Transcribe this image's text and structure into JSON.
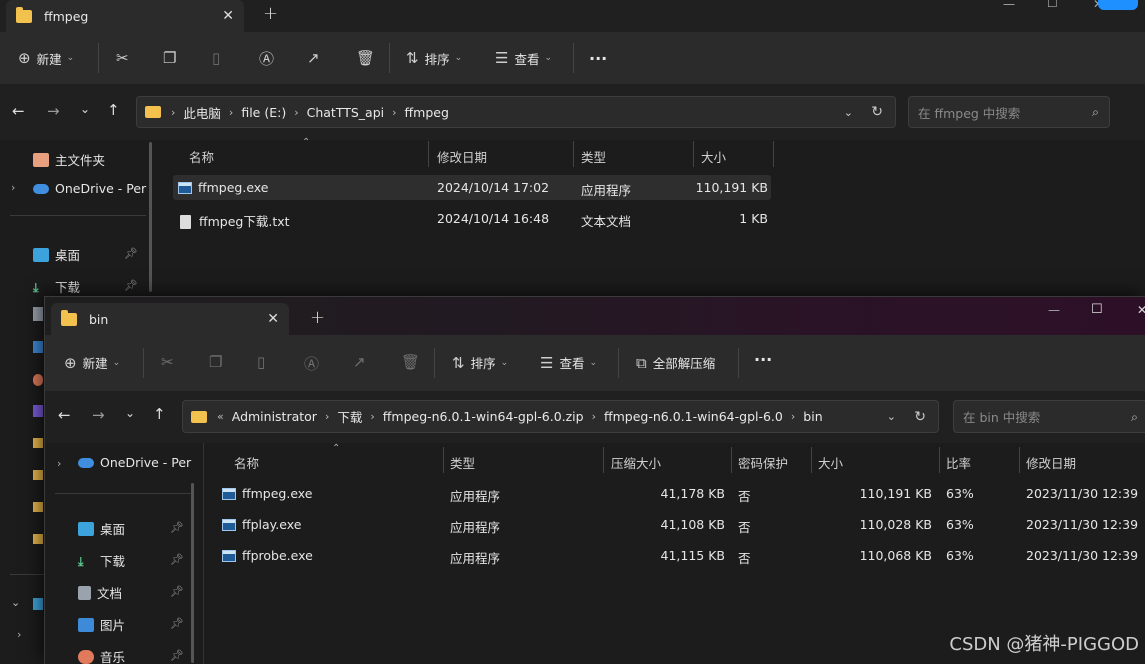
{
  "back_window": {
    "tab_title": "ffmpeg",
    "toolbar": {
      "new_label": "新建",
      "sort_label": "排序",
      "view_label": "查看",
      "more": "···"
    },
    "breadcrumb": [
      "此电脑",
      "file (E:)",
      "ChatTTS_api",
      "ffmpeg"
    ],
    "search_placeholder": "在 ffmpeg 中搜索",
    "nav": [
      {
        "label": "主文件夹",
        "icon": "home-icon"
      },
      {
        "label": "OneDrive - Per",
        "icon": "onedrive-icon"
      },
      {
        "label": "桌面",
        "icon": "desktop-icon"
      },
      {
        "label": "下载",
        "icon": "download-icon"
      }
    ],
    "columns": [
      "名称",
      "修改日期",
      "类型",
      "大小"
    ],
    "files": [
      {
        "name": "ffmpeg.exe",
        "date": "2024/10/14 17:02",
        "type": "应用程序",
        "size": "110,191 KB",
        "icon": "exe-icon"
      },
      {
        "name": "ffmpeg下载.txt",
        "date": "2024/10/14 16:48",
        "type": "文本文档",
        "size": "1 KB",
        "icon": "text-file-icon"
      }
    ]
  },
  "front_window": {
    "tab_title": "bin",
    "toolbar": {
      "new_label": "新建",
      "sort_label": "排序",
      "view_label": "查看",
      "extract_label": "全部解压缩",
      "more": "···"
    },
    "breadcrumb_prefix": "«",
    "breadcrumb": [
      "Administrator",
      "下载",
      "ffmpeg-n6.0.1-win64-gpl-6.0.zip",
      "ffmpeg-n6.0.1-win64-gpl-6.0",
      "bin"
    ],
    "search_placeholder": "在 bin 中搜索",
    "nav": [
      {
        "label": "OneDrive - Per",
        "icon": "onedrive-icon"
      },
      {
        "label": "桌面",
        "icon": "desktop-icon"
      },
      {
        "label": "下载",
        "icon": "download-icon"
      },
      {
        "label": "文档",
        "icon": "documents-icon"
      },
      {
        "label": "图片",
        "icon": "pictures-icon"
      },
      {
        "label": "音乐",
        "icon": "music-icon"
      }
    ],
    "columns": [
      "名称",
      "类型",
      "压缩大小",
      "密码保护",
      "大小",
      "比率",
      "修改日期"
    ],
    "files": [
      {
        "name": "ffmpeg.exe",
        "type": "应用程序",
        "packed": "41,178 KB",
        "password": "否",
        "size": "110,191 KB",
        "ratio": "63%",
        "date": "2023/11/30 12:39"
      },
      {
        "name": "ffplay.exe",
        "type": "应用程序",
        "packed": "41,108 KB",
        "password": "否",
        "size": "110,028 KB",
        "ratio": "63%",
        "date": "2023/11/30 12:39"
      },
      {
        "name": "ffprobe.exe",
        "type": "应用程序",
        "packed": "41,115 KB",
        "password": "否",
        "size": "110,068 KB",
        "ratio": "63%",
        "date": "2023/11/30 12:39"
      }
    ]
  },
  "watermark": "CSDN @猪神-PIGGOD"
}
